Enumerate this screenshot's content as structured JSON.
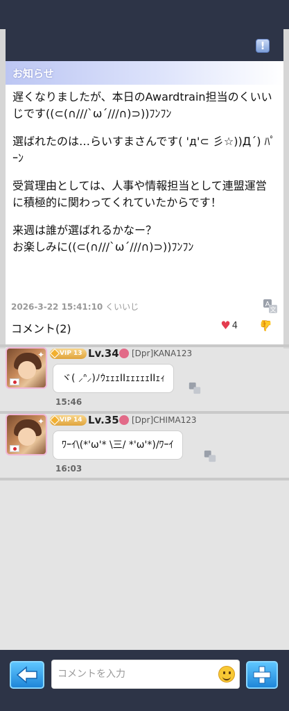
{
  "notice": {
    "title": "お知らせ",
    "paragraphs": [
      "遅くなりましたが、本日のAwardtrain担当のくいいじです((⊂(∩///`ω´///∩)⊃))ﾌﾝﾌﾝ",
      "選ばれたのは…らいすまさんです( 'д'⊂ 彡☆))Д´) ﾊﾟｰﾝ",
      "受賞理由としては、人事や情報担当として連盟運営に積極的に関わってくれていたからです！",
      "来週は誰が選ばれるかなー？\nお楽しみに((⊂(∩///`ω´///∩)⊃))ﾌﾝﾌﾝ"
    ],
    "date": "2026-3-22 15:41:10",
    "author": "くいいじ",
    "comments_label": "コメント(2)",
    "like_count": "4"
  },
  "comments": [
    {
      "vip": "VIP 13",
      "level": "Lv.34",
      "username": "[Dpr]KANA123",
      "text": "ヾ( ⸝ᐢ⸝)ﾉｳｪｪｪIIｪｪｪｪｪIIｪｨ",
      "time": "15:46"
    },
    {
      "vip": "VIP 14",
      "level": "Lv.35",
      "username": "[Dpr]CHIMA123",
      "text": "ﾜｰｲ\\(*'ω'* \\三/ *'ω'*)/ﾜｰｲ",
      "time": "16:03"
    }
  ],
  "input": {
    "placeholder": "コメントを入力"
  },
  "colors": {
    "header_bg": "#2d3447",
    "like": "#e43c4f",
    "accent": "#3aa3ef"
  }
}
